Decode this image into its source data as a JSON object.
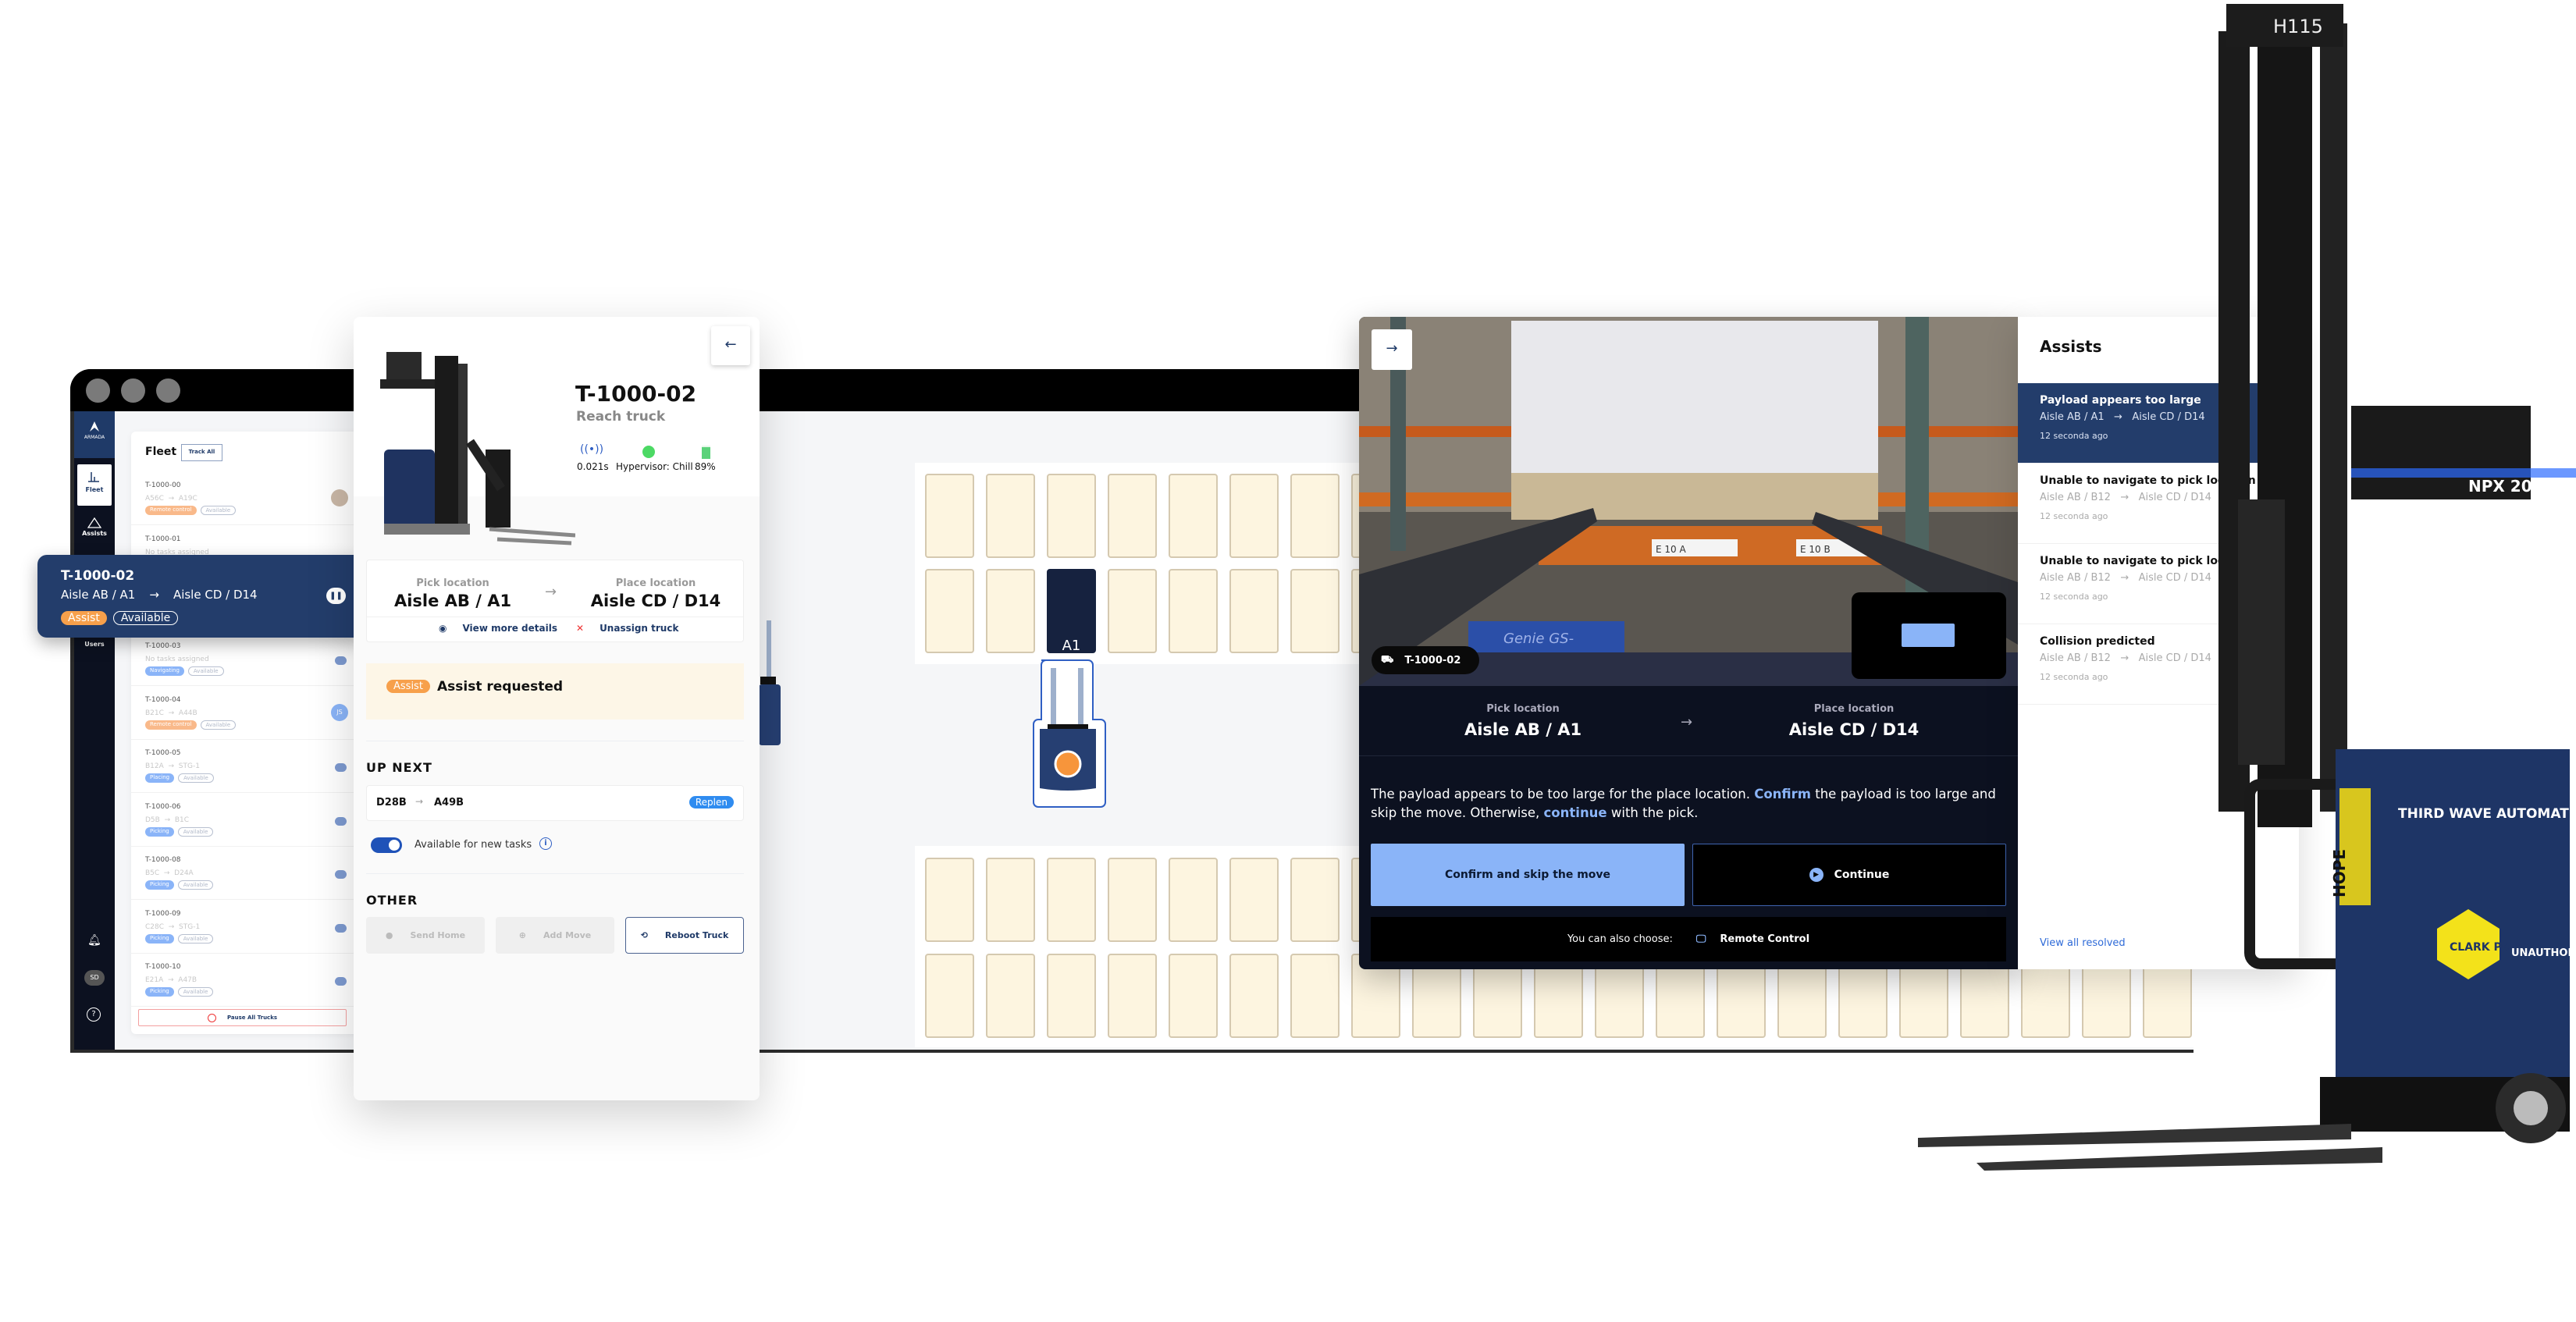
{
  "brand": {
    "logo_text": "ARMADA"
  },
  "sidebar": {
    "items": [
      {
        "label": "Fleet",
        "icon": "forklift-icon"
      },
      {
        "label": "Assists",
        "icon": "warning-icon"
      },
      {
        "label": "Users",
        "icon": "users-icon"
      }
    ],
    "avatar": "SD"
  },
  "fleet": {
    "title": "Fleet",
    "track_all": "Track All",
    "pause_all": "Pause All Trucks",
    "rows": [
      {
        "id": "T-1000-00",
        "route": [
          "A56C",
          "A19C"
        ],
        "badges": [
          {
            "label": "Remote control",
            "color": "#f9b98a"
          },
          {
            "label": "Available",
            "outline": true
          }
        ],
        "avatar": "photo"
      },
      {
        "id": "T-1000-01",
        "note": "No tasks assigned",
        "badges": []
      },
      {
        "id": "T-1000-03",
        "note": "No tasks assigned",
        "badges": [
          {
            "label": "Navigating",
            "color": "#8ab4f8"
          },
          {
            "label": "Available",
            "outline": true
          }
        ],
        "pause": true
      },
      {
        "id": "T-1000-04",
        "route": [
          "B21C",
          "A44B"
        ],
        "badges": [
          {
            "label": "Remote control",
            "color": "#f9b98a"
          },
          {
            "label": "Available",
            "outline": true
          }
        ],
        "avatar": "JS"
      },
      {
        "id": "T-1000-05",
        "route": [
          "B12A",
          "STG-1"
        ],
        "badges": [
          {
            "label": "Placing",
            "color": "#8ab4f8"
          },
          {
            "label": "Available",
            "outline": true
          }
        ],
        "pause": true
      },
      {
        "id": "T-1000-06",
        "route": [
          "D5B",
          "B1C"
        ],
        "badges": [
          {
            "label": "Picking",
            "color": "#8ab4f8"
          },
          {
            "label": "Available",
            "outline": true
          }
        ],
        "pause": true
      },
      {
        "id": "T-1000-08",
        "route": [
          "B5C",
          "D24A"
        ],
        "badges": [
          {
            "label": "Picking",
            "color": "#8ab4f8"
          },
          {
            "label": "Available",
            "outline": true
          }
        ],
        "pause": true
      },
      {
        "id": "T-1000-09",
        "route": [
          "C28C",
          "STG-1"
        ],
        "badges": [
          {
            "label": "Picking",
            "color": "#8ab4f8"
          },
          {
            "label": "Available",
            "outline": true
          }
        ],
        "pause": true
      },
      {
        "id": "T-1000-10",
        "route": [
          "E21A",
          "A47B"
        ],
        "badges": [
          {
            "label": "Picking",
            "color": "#8ab4f8"
          },
          {
            "label": "Available",
            "outline": true
          }
        ],
        "pause": true
      }
    ]
  },
  "selected_card": {
    "id": "T-1000-02",
    "from": "Aisle AB / A1",
    "to": "Aisle CD / D14",
    "badge_assist": "Assist",
    "badge_status": "Available"
  },
  "detail": {
    "title": "T-1000-02",
    "subtitle": "Reach truck",
    "latency": "0.021s",
    "hypervisor": "Hypervisor: Chill",
    "battery": "89%",
    "battery_level": 89,
    "pick_label": "Pick location",
    "pick_value": "Aisle AB / A1",
    "place_label": "Place location",
    "place_value": "Aisle CD / D14",
    "view_details": "View more details",
    "unassign": "Unassign truck",
    "assist_badge": "Assist",
    "assist_text": "Assist requested",
    "up_next_heading": "UP NEXT",
    "up_next": {
      "from": "D28B",
      "to": "A49B",
      "tag": "Replen"
    },
    "toggle_label": "Available for new tasks",
    "toggle_on": true,
    "other_heading": "OTHER",
    "send_home": "Send Home",
    "add_move": "Add Move",
    "reboot": "Reboot Truck"
  },
  "map": {
    "highlight_label": "A1"
  },
  "camera": {
    "truck_label": "T-1000-02",
    "pick_label": "Pick location",
    "pick_value": "Aisle AB / A1",
    "place_label": "Place location",
    "place_value": "Aisle CD / D14",
    "message_1": "The payload appears to be too large for the place location. ",
    "message_confirm": "Confirm",
    "message_2": " the payload is too large and skip the move. Otherwise, ",
    "message_continue": "continue",
    "message_3": " with the pick.",
    "confirm_button": "Confirm and skip the move",
    "continue_button": "Continue",
    "also_choose": "You can also choose:",
    "remote_control": "Remote Control",
    "rack_labels": [
      "E 10 A",
      "E 10 B"
    ],
    "lift_brand": "Genie GS-"
  },
  "assists": {
    "title": "Assists",
    "view_all": "View all resolved",
    "items": [
      {
        "title": "Payload appears too large",
        "from": "Aisle AB / A1",
        "to": "Aisle CD / D14",
        "time": "12 seconda ago",
        "selected": true
      },
      {
        "title": "Unable to navigate to pick location",
        "from": "Aisle AB / B12",
        "to": "Aisle CD / D14",
        "time": "12 seconda ago"
      },
      {
        "title": "Unable to navigate to pick location",
        "from": "Aisle AB / B12",
        "to": "Aisle CD / D14",
        "time": "12 seconda ago"
      },
      {
        "title": "Collision predicted",
        "from": "Aisle AB / B12",
        "to": "Aisle CD / D14",
        "time": "12 seconda ago"
      }
    ]
  },
  "forklift_photo": {
    "mast_label": "H115",
    "model": "NPX 20",
    "brand": "THIRD WAVE AUTOMATION",
    "warning": "UNAUTHORIZED RIDING PROHIBITED",
    "sticker_1": "CLARK PARTS",
    "sticker_2": "HOPE"
  },
  "colors": {
    "navy": "#233d6b",
    "assist_orange": "#f7a04b",
    "accent_blue": "#8ab4f8",
    "dark": "#0c1120",
    "shelf": "#fdf5e0"
  }
}
